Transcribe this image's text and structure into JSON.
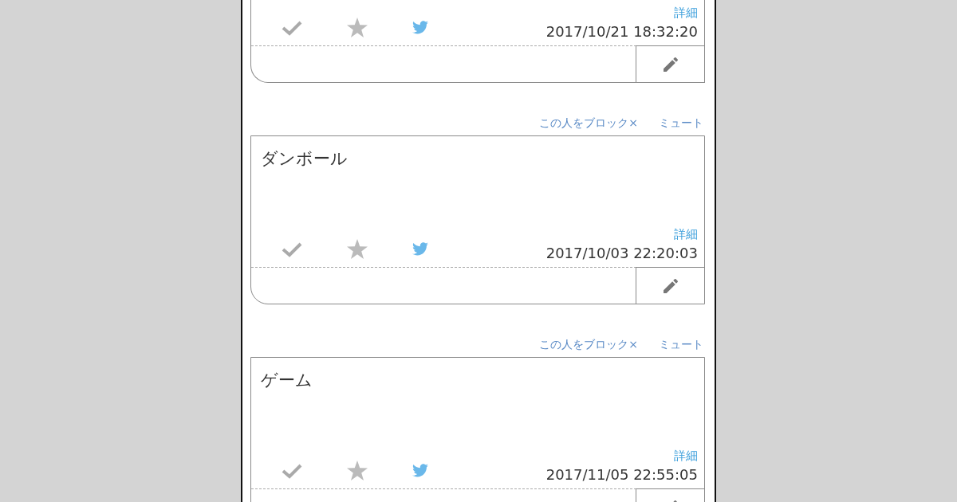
{
  "posts": [
    {
      "detail_link": "詳細",
      "timestamp": "2017/10/21 18:32:20"
    },
    {
      "block_link": "この人をブロック×",
      "mute_link": "ミュート",
      "title": "ダンボール",
      "detail_link": "詳細",
      "timestamp": "2017/10/03 22:20:03"
    },
    {
      "block_link": "この人をブロック×",
      "mute_link": "ミュート",
      "title": "ゲーム",
      "detail_link": "詳細",
      "timestamp": "2017/11/05 22:55:05"
    }
  ]
}
